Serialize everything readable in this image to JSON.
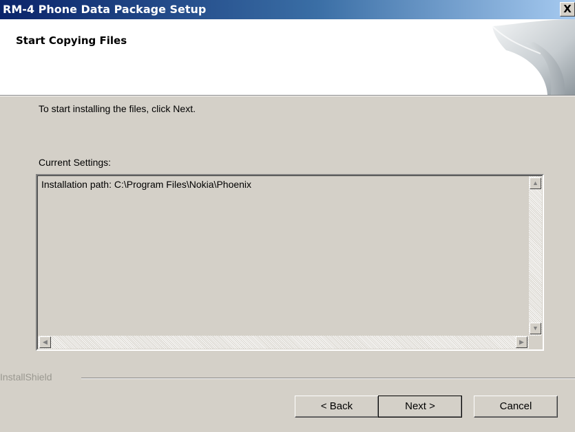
{
  "window": {
    "title": "RM-4 Phone Data Package Setup",
    "close_glyph": "X",
    "title_gradient": [
      "#0a246a",
      "#a6caf0"
    ]
  },
  "header": {
    "title": "Start Copying Files",
    "art_icon": "installshield-swirl-icon"
  },
  "body": {
    "instruction": "To start installing the files, click Next.",
    "settings_label": "Current Settings:",
    "settings_text": "Installation path: C:\\Program Files\\Nokia\\Phoenix"
  },
  "footer": {
    "brand": "InstallShield"
  },
  "buttons": {
    "back": "< Back",
    "next": "Next >",
    "cancel": "Cancel"
  },
  "scrollbar_glyphs": {
    "up": "▲",
    "down": "▼",
    "left": "◀",
    "right": "▶"
  }
}
